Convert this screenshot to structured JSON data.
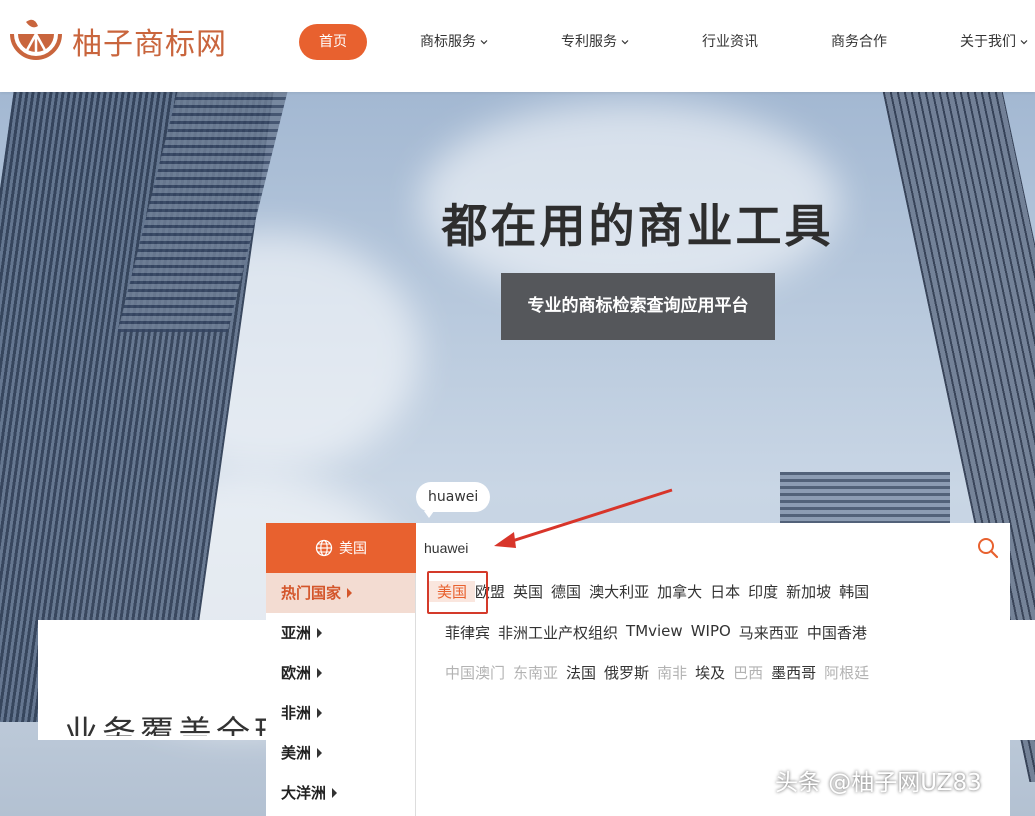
{
  "brand": {
    "name": "柚子商标网",
    "color": "#c9653d"
  },
  "nav": {
    "items": [
      {
        "label": "首页",
        "active": true,
        "dropdown": false
      },
      {
        "label": "商标服务",
        "active": false,
        "dropdown": true
      },
      {
        "label": "专利服务",
        "active": false,
        "dropdown": true
      },
      {
        "label": "行业资讯",
        "active": false,
        "dropdown": false
      },
      {
        "label": "商务合作",
        "active": false,
        "dropdown": false
      },
      {
        "label": "关于我们",
        "active": false,
        "dropdown": true
      }
    ],
    "accent": "#e8612f"
  },
  "hero": {
    "title": "都在用的商业工具",
    "subtitle": "专业的商标检索查询应用平台"
  },
  "search": {
    "country_label": "美国",
    "value": "huawei",
    "tooltip": "huawei",
    "icons": {
      "globe": "globe-icon",
      "search": "search-icon"
    }
  },
  "regions": [
    {
      "label": "热门国家",
      "active": true
    },
    {
      "label": "亚洲",
      "active": false
    },
    {
      "label": "欧洲",
      "active": false
    },
    {
      "label": "非洲",
      "active": false
    },
    {
      "label": "美洲",
      "active": false
    },
    {
      "label": "大洋洲",
      "active": false
    }
  ],
  "countries": {
    "row1": [
      "美国",
      "欧盟",
      "英国",
      "德国",
      "澳大利亚",
      "加拿大",
      "日本",
      "印度",
      "新加坡",
      "韩国"
    ],
    "row2": [
      "菲律宾",
      "非洲工业产权组织",
      "TMview",
      "WIPO",
      "马来西亚",
      "中国香港"
    ],
    "row3": [
      {
        "label": "中国澳门",
        "dim": true
      },
      {
        "label": "东南亚",
        "dim": true
      },
      {
        "label": "法国",
        "dim": false
      },
      {
        "label": "俄罗斯",
        "dim": false
      },
      {
        "label": "南非",
        "dim": true
      },
      {
        "label": "埃及",
        "dim": false
      },
      {
        "label": "巴西",
        "dim": true
      },
      {
        "label": "墨西哥",
        "dim": false
      },
      {
        "label": "阿根廷",
        "dim": true
      }
    ],
    "selected": "美国"
  },
  "lower": {
    "partial_text": "业务覆盖全球"
  },
  "watermark": "头条 @柚子网UZ83"
}
